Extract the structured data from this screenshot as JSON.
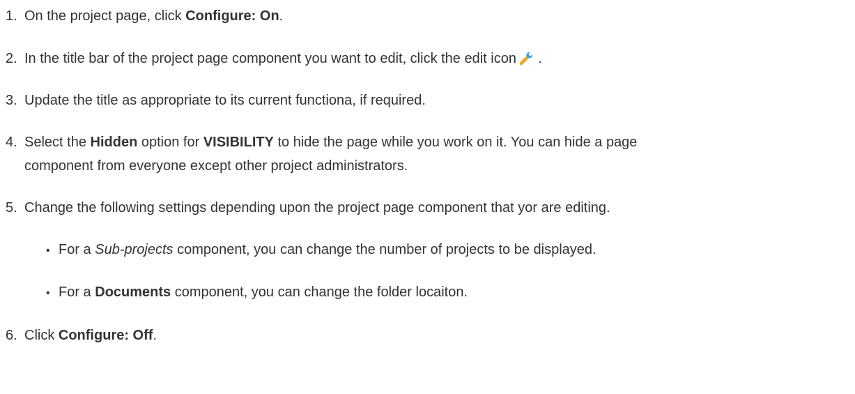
{
  "steps": [
    {
      "num": "1.",
      "a": "On the project page, click ",
      "b": "Configure: On",
      "c": "."
    },
    {
      "num": "2.",
      "a": "In the title bar of the project page component you want to edit, click the edit icon",
      "icon": "wrench-icon",
      "c": " ."
    },
    {
      "num": "3.",
      "a": "Update the title as appropriate to its current functiona, if required."
    },
    {
      "num": "4.",
      "a": "Select the ",
      "b1": "Hidden",
      "a2": " option for ",
      "b2": "VISIBILITY",
      "a3": " to hide the page while you work on it. You can hide a page",
      "line2": "component from everyone except other project administrators."
    },
    {
      "num": "5.",
      "a": "Change the following settings depending upon the project page component that yor are editing."
    },
    {
      "num": "6.",
      "a": "Click ",
      "b": "Configure: Off",
      "c": "."
    }
  ],
  "substeps": [
    {
      "bullet": "•",
      "a": "For a ",
      "em": "Sub-projects",
      "c": " component, you can change the number of projects to be displayed."
    },
    {
      "bullet": "•",
      "a": "For a ",
      "strong": "Documents",
      "c": " component, you can change the folder locaiton."
    }
  ],
  "colors": {
    "text": "#333333",
    "icon_handle": "#f2a51c",
    "icon_head": "#2aa6e0"
  }
}
